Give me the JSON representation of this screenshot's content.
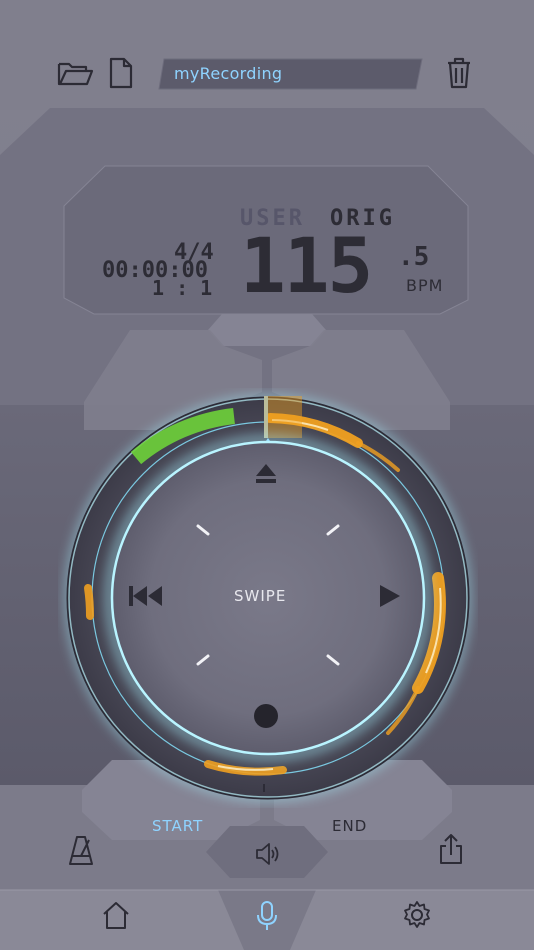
{
  "header": {
    "file_name": "myRecording"
  },
  "display": {
    "mode_user": "USER",
    "mode_orig": "ORIG",
    "time_signature": "4/4",
    "timecode": "00:00:00",
    "bar_beat": "1 : 1",
    "tempo_main": "115",
    "tempo_decimal": ".5",
    "tempo_unit": "BPM"
  },
  "wheel": {
    "center_label": "SWIPE"
  },
  "transport": {
    "start_label": "START",
    "end_label": "END"
  },
  "icons": {
    "open": "folder-open-icon",
    "new": "new-file-icon",
    "delete": "trash-icon",
    "eject": "eject-icon",
    "rewind": "skip-back-icon",
    "play": "play-icon",
    "record": "record-icon",
    "metronome": "metronome-icon",
    "volume": "speaker-icon",
    "share": "share-icon",
    "home": "home-icon",
    "microphone": "microphone-icon",
    "settings": "gear-icon"
  },
  "colors": {
    "accent_blue": "#8fd3ff",
    "waveform_orange": "#f0a020",
    "loop_green": "#6ed13a",
    "ring_glow": "#a6f2ff"
  }
}
